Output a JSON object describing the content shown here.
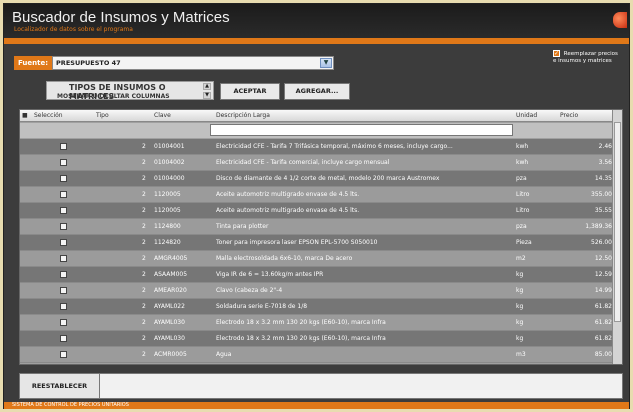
{
  "window": {
    "title": "Buscador de Insumos y Matrices",
    "subtitle": "Localizador de datos sobre el programa",
    "status": "SISTEMA DE CONTROL DE PRECIOS UNITARIOS"
  },
  "filter": {
    "label": "Fuente:",
    "value": "PRESUPUESTO 47",
    "option": "Reemplazar precios e insumos y matrices"
  },
  "types": {
    "title": "TIPOS DE INSUMOS O MATRICES",
    "subtitle": "MOSTRAR U OCULTAR COLUMNAS"
  },
  "buttons": {
    "accept": "ACEPTAR",
    "add": "AGREGAR...",
    "reset": "REESTABLECER"
  },
  "grid": {
    "headers": [
      "Selección",
      "Tipo",
      "Clave",
      "Descripción Larga",
      "Unidad",
      "Precio"
    ],
    "rows": [
      {
        "tipo": "2",
        "clave": "01004001",
        "desc": "Electricidad CFE - Tarifa 7 Trifásica temporal, máximo 6 meses, incluye cargo...",
        "unidad": "kwh",
        "precio": "2.46"
      },
      {
        "tipo": "2",
        "clave": "01004002",
        "desc": "Electricidad CFE - Tarifa comercial, incluye cargo mensual",
        "unidad": "kwh",
        "precio": "3.56"
      },
      {
        "tipo": "2",
        "clave": "01004000",
        "desc": "Disco de diamante de 4 1/2 corte de metal, modelo 200 marca Austromex",
        "unidad": "pza",
        "precio": "14.35"
      },
      {
        "tipo": "2",
        "clave": "1120005",
        "desc": "Aceite automotriz multigrado envase de 4.5 lts.",
        "unidad": "Litro",
        "precio": "355.00"
      },
      {
        "tipo": "2",
        "clave": "1120005",
        "desc": "Aceite automotriz multigrado envase de 4.5 lts.",
        "unidad": "Litro",
        "precio": "35.55"
      },
      {
        "tipo": "2",
        "clave": "1124800",
        "desc": "Tinta para plotter",
        "unidad": "pza",
        "precio": "1,389.36"
      },
      {
        "tipo": "2",
        "clave": "1124820",
        "desc": "Toner para impresora laser EPSON EPL-5700 S050010",
        "unidad": "Pieza",
        "precio": "526.00"
      },
      {
        "tipo": "2",
        "clave": "AMGR4005",
        "desc": "Malla electrosoldada 6x6-10, marca De acero",
        "unidad": "m2",
        "precio": "12.50"
      },
      {
        "tipo": "2",
        "clave": "ASAAM005",
        "desc": "Viga IR de 6 = 13.60kg/m antes IPR",
        "unidad": "kg",
        "precio": "12.59"
      },
      {
        "tipo": "2",
        "clave": "AMEAR020",
        "desc": "Clavo (cabeza de 2\"-4",
        "unidad": "kg",
        "precio": "14.99"
      },
      {
        "tipo": "2",
        "clave": "AYAML022",
        "desc": "Soldadura serie E-7018 de 1/8",
        "unidad": "kg",
        "precio": "61.82"
      },
      {
        "tipo": "2",
        "clave": "AYAML030",
        "desc": "Electrodo 18 x 3.2 mm 130 20 kgs (E60-10), marca Infra",
        "unidad": "kg",
        "precio": "61.82"
      },
      {
        "tipo": "2",
        "clave": "AYAML030",
        "desc": "Electrodo 18 x 3.2 mm 130 20 kgs (E60-10), marca Infra",
        "unidad": "kg",
        "precio": "61.82"
      },
      {
        "tipo": "2",
        "clave": "ACMR0005",
        "desc": "Agua",
        "unidad": "m3",
        "precio": "85.00"
      }
    ]
  },
  "colors": {
    "accent": "#e07818",
    "row_dark": "#767676",
    "row_mid": "#9b9b9b"
  }
}
